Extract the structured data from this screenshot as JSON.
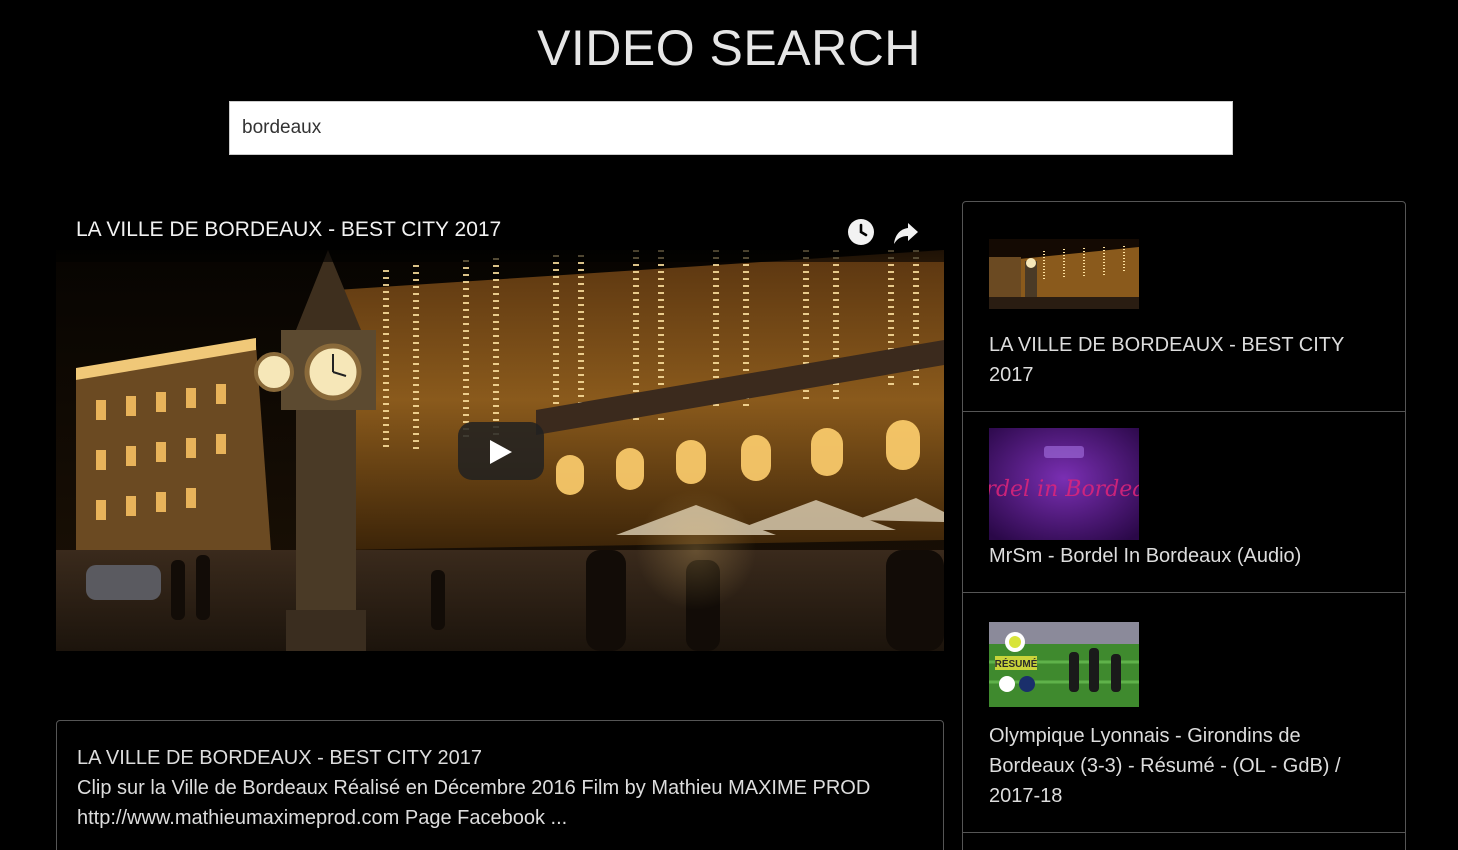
{
  "page": {
    "title": "VIDEO SEARCH"
  },
  "search": {
    "value": "bordeaux"
  },
  "player": {
    "title": "LA VILLE DE BORDEAUX - BEST CITY 2017",
    "icons": [
      "clock-icon",
      "share-icon",
      "play-icon"
    ]
  },
  "description": {
    "title": "LA VILLE DE BORDEAUX - BEST CITY 2017",
    "body": "Clip sur la Ville de Bordeaux Réalisé en Décembre 2016 Film by Mathieu MAXIME PROD http://www.mathieumaximeprod.com Page Facebook ..."
  },
  "results": [
    {
      "title": "LA VILLE DE BORDEAUX - BEST CITY 2017"
    },
    {
      "title": "MrSm - Bordel In Bordeaux (Audio)",
      "thumb_text": "Bordel in Bordeaux"
    },
    {
      "title": "Olympique Lyonnais - Girondins de Bordeaux (3-3) - Résumé - (OL - GdB) / 2017-18",
      "thumb_text": "RÉSUMÉ"
    }
  ],
  "colors": {
    "background": "#000000",
    "text": "#dddddd",
    "border": "#555555",
    "search_bg": "#ffffff"
  }
}
